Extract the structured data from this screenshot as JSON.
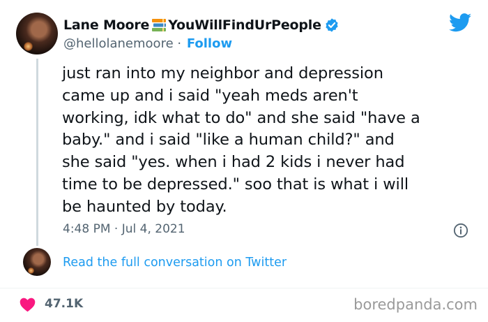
{
  "author": {
    "display_name": "Lane Moore",
    "display_name_suffix": "YouWillFindUrPeople",
    "handle": "@hellolanemoore",
    "separator": " · ",
    "follow_label": "Follow",
    "verified": true
  },
  "tweet": {
    "text": "just ran into my neighbor and depression\ncame up and i said \"yeah meds aren't\nworking, idk what to do\" and she said \"have a\nbaby.\" and i said \"like a human child?\" and\nshe said \"yes. when i had 2 kids i never had\ntime to be depressed.\" soo that is what i will\nbe haunted by today.",
    "timestamp": "4:48 PM · Jul 4, 2021"
  },
  "conversation": {
    "link_label": "Read the full conversation on Twitter"
  },
  "engagement": {
    "likes": "47.1K"
  },
  "watermark": "boredpanda.com",
  "icons": {
    "brand": "twitter-bird-icon",
    "name_emoji": "books-icon",
    "verified": "verified-badge-icon",
    "info": "info-icon",
    "like": "heart-icon"
  },
  "colors": {
    "accent": "#1d9bf0",
    "text": "#0f1419",
    "secondary": "#536471",
    "heart": "#f91880",
    "divider": "#eff3f4"
  }
}
